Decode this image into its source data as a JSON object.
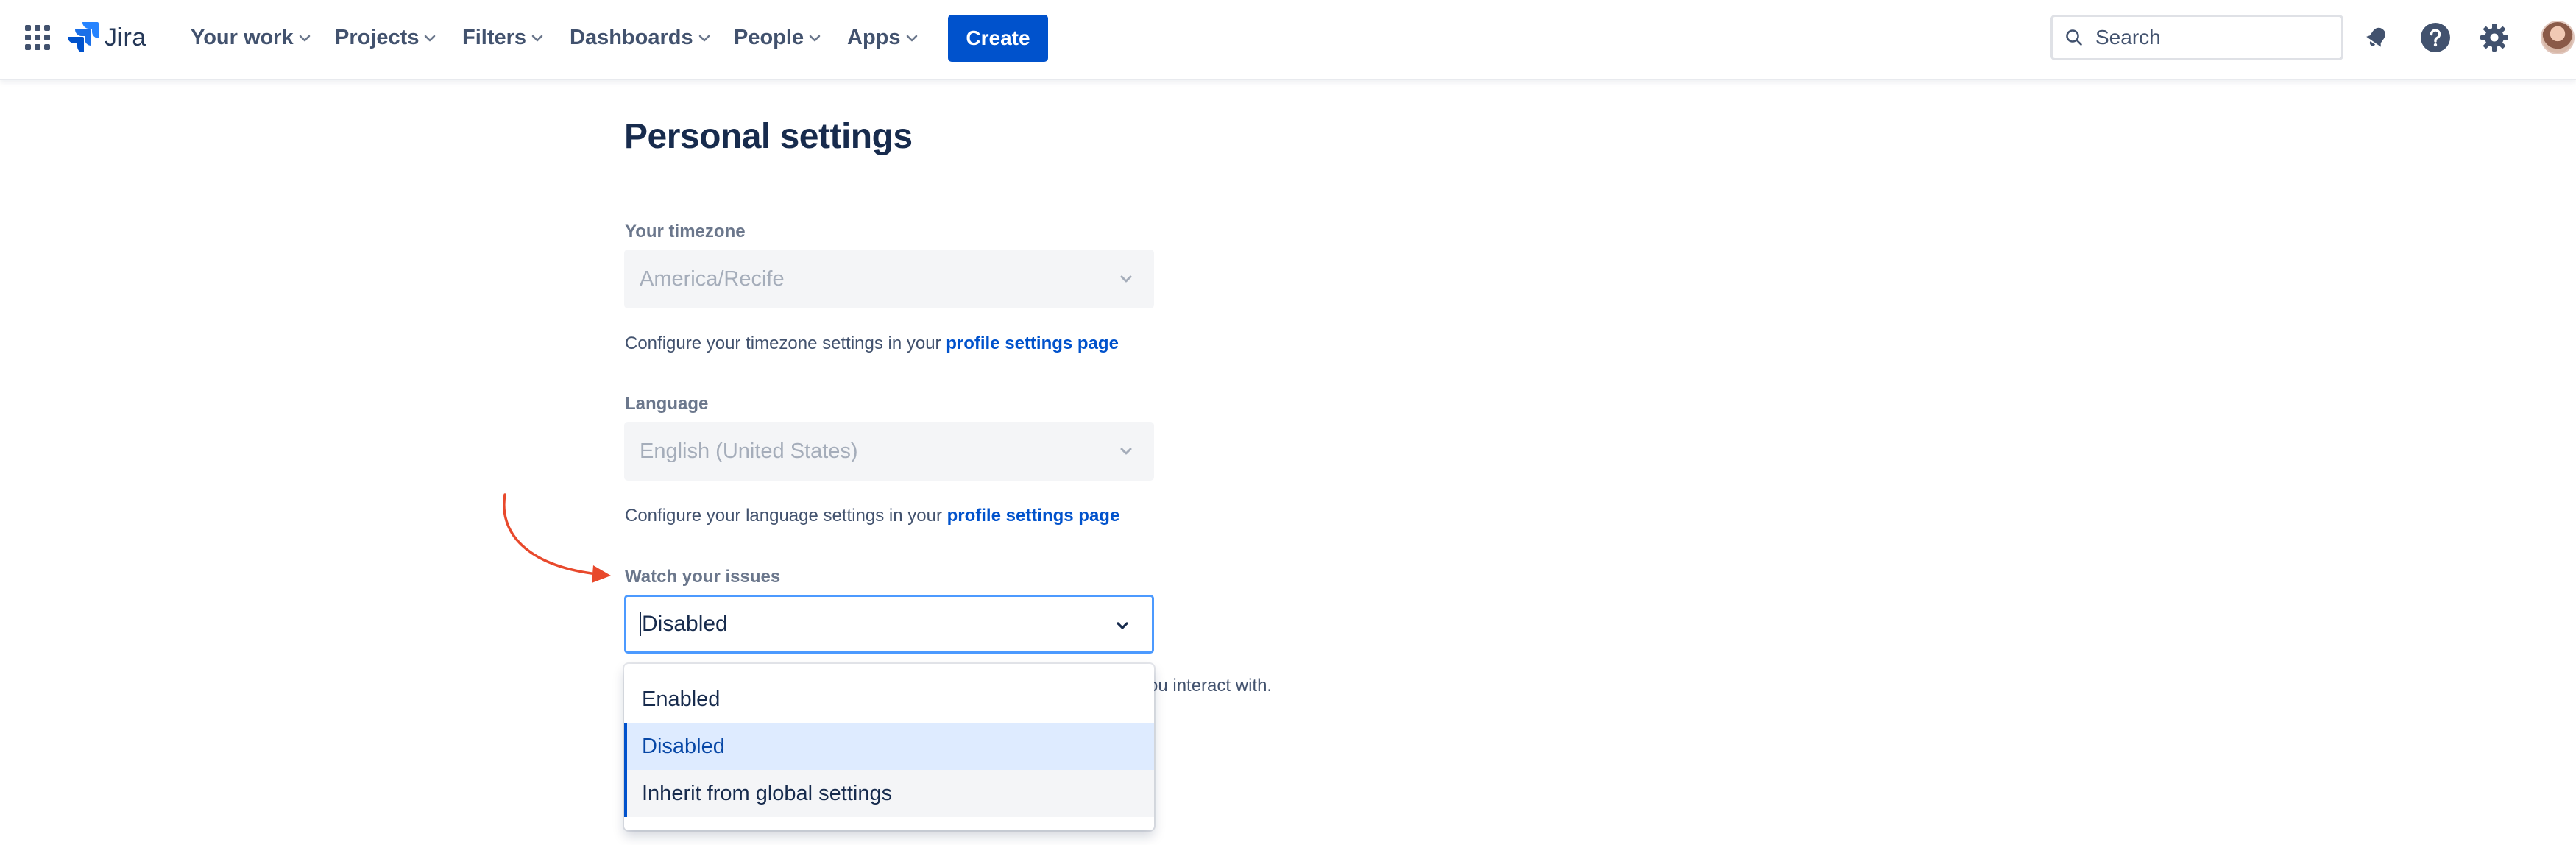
{
  "topbar": {
    "logo_text": "Jira",
    "nav": [
      "Your work",
      "Projects",
      "Filters",
      "Dashboards",
      "People",
      "Apps"
    ],
    "create_label": "Create",
    "search_placeholder": "Search"
  },
  "page": {
    "title": "Personal settings"
  },
  "timezone": {
    "label": "Your timezone",
    "value": "America/Recife",
    "helper_prefix": "Configure your timezone settings in your ",
    "helper_link": "profile settings page"
  },
  "language": {
    "label": "Language",
    "value": "English (United States)",
    "helper_prefix": "Configure your language settings in your ",
    "helper_link": "profile settings page"
  },
  "watch": {
    "label": "Watch your issues",
    "value": "Disabled",
    "helper_visible": "ou interact with.",
    "options": [
      "Enabled",
      "Disabled",
      "Inherit from global settings"
    ]
  },
  "colors": {
    "primary": "#0052cc",
    "focus_border": "#4c9aff",
    "selected_bg": "#deebff",
    "annotation_arrow": "#e8492c"
  },
  "icons": {
    "app_switcher": "grid-icon",
    "logo": "jira-logo-icon",
    "search": "search-icon",
    "notifications": "bell-icon",
    "help": "help-icon",
    "settings": "gear-icon",
    "chevron": "chevron-down-icon"
  }
}
